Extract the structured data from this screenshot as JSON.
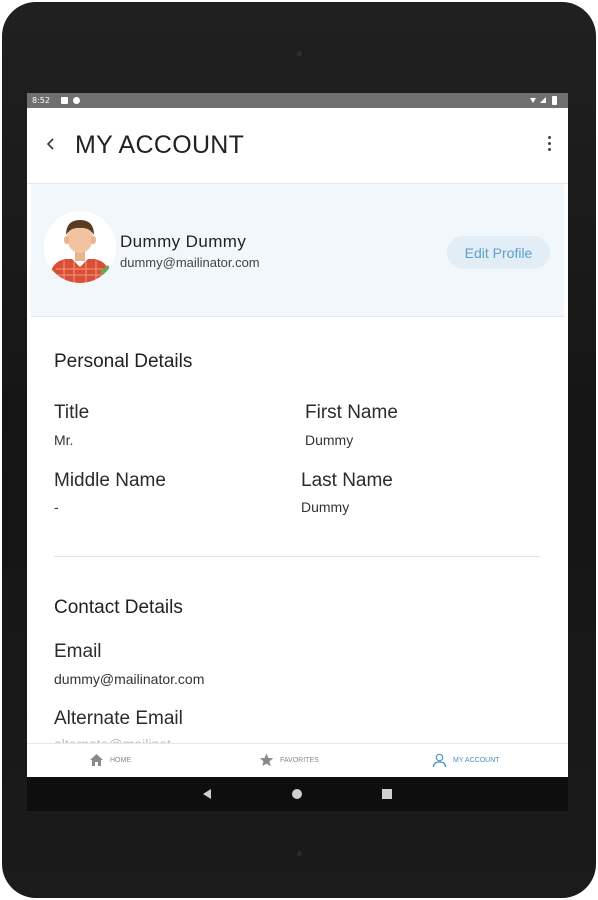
{
  "statusbar": {
    "time": "8:52"
  },
  "appbar": {
    "title": "MY ACCOUNT"
  },
  "profile": {
    "name": "Dummy Dummy",
    "email": "dummy@mailinator.com",
    "edit_label": "Edit Profile"
  },
  "personal": {
    "section_title": "Personal Details",
    "title_label": "Title",
    "title_value": "Mr.",
    "first_name_label": "First Name",
    "first_name_value": "Dummy",
    "middle_name_label": "Middle Name",
    "middle_name_value": "-",
    "last_name_label": "Last Name",
    "last_name_value": "Dummy"
  },
  "contact": {
    "section_title": "Contact Details",
    "email_label": "Email",
    "email_value": "dummy@mailinator.com",
    "alt_email_label": "Alternate Email",
    "alt_email_value": "alternate@mailinat"
  },
  "nav": {
    "home_label": "HOME",
    "favorites_label": "FAVORITES",
    "account_label": "MY ACCOUNT",
    "active": "account",
    "active_color": "#4a8fbf"
  },
  "icons": {
    "back": "chevron-left-icon",
    "more": "more-vertical-icon",
    "home": "home-icon",
    "favorites": "star-icon",
    "account": "user-icon"
  },
  "colors": {
    "profile_bg": "#f1f7fb",
    "edit_button_bg": "#e3edf5",
    "edit_button_text": "#5aa0cf"
  }
}
